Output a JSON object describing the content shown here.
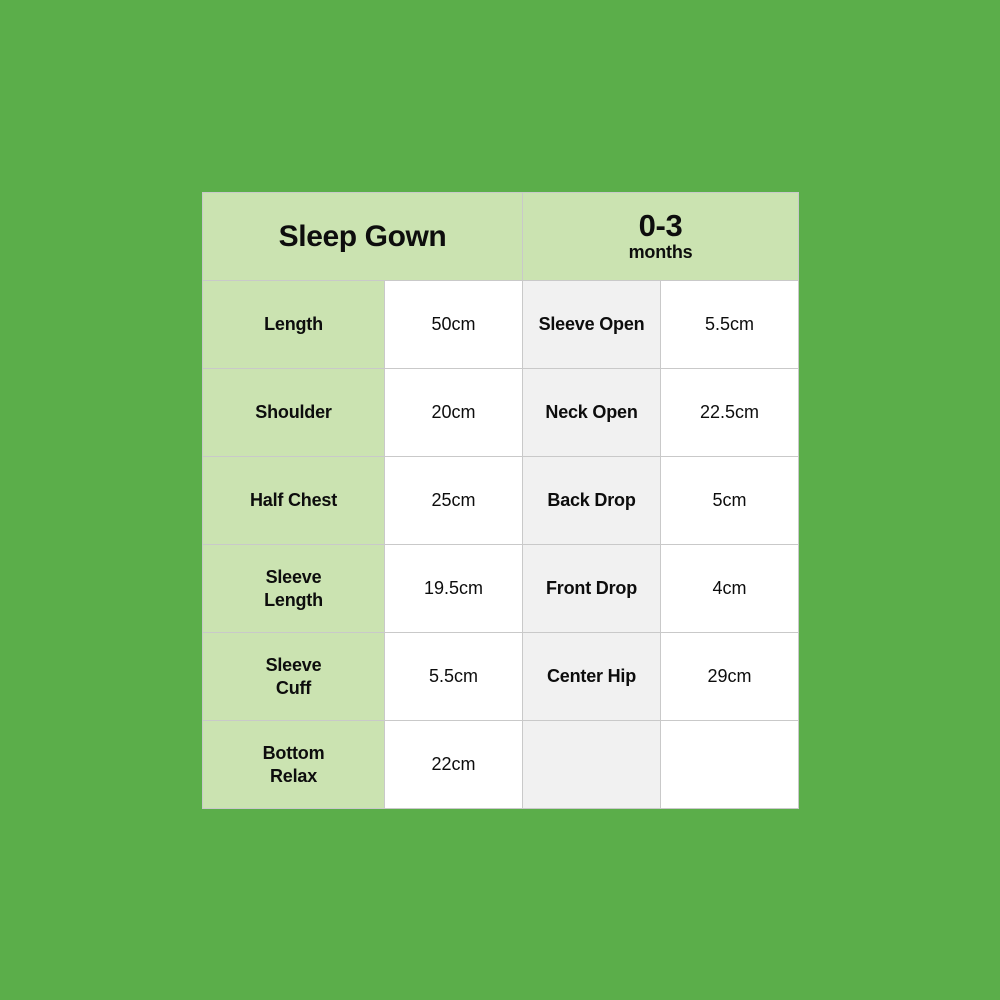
{
  "page": {
    "background_color": "#5BAE4A",
    "card_background": "#FFFFFF",
    "accent_green": "#CBE3B1",
    "alt_cell_gray": "#F1F1F1",
    "border_color": "#C9C9C9"
  },
  "header": {
    "title": "Sleep Gown",
    "size_label_main": "0-3",
    "size_label_sub": "months"
  },
  "table": {
    "rows": [
      {
        "label_left": "Length",
        "value_left": "50cm",
        "label_right": "Sleeve Open",
        "value_right": "5.5cm"
      },
      {
        "label_left": "Shoulder",
        "value_left": "20cm",
        "label_right": "Neck Open",
        "value_right": "22.5cm"
      },
      {
        "label_left": "Half Chest",
        "value_left": "25cm",
        "label_right": "Back Drop",
        "value_right": "5cm"
      },
      {
        "label_left": "Sleeve\nLength",
        "value_left": "19.5cm",
        "label_right": "Front Drop",
        "value_right": "4cm"
      },
      {
        "label_left": "Sleeve\nCuff",
        "value_left": "5.5cm",
        "label_right": "Center Hip",
        "value_right": "29cm"
      },
      {
        "label_left": "Bottom\nRelax",
        "value_left": "22cm",
        "label_right": "",
        "value_right": ""
      }
    ]
  }
}
